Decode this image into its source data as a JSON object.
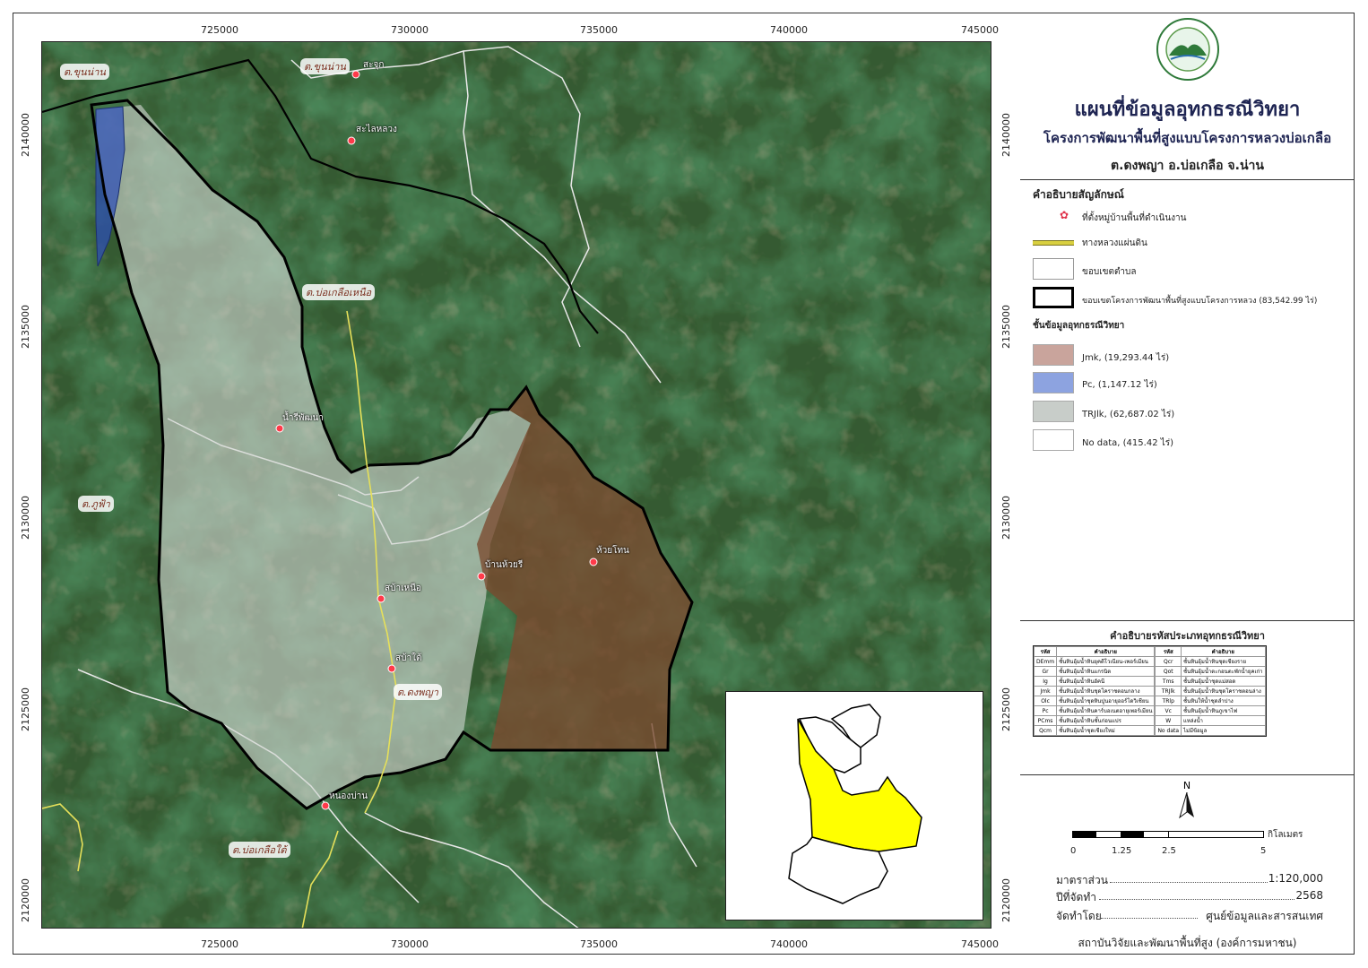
{
  "header": {
    "title": "แผนที่ข้อมูลอุทกธรณีวิทยา",
    "subtitle": "โครงการพัฒนาพื้นที่สูงแบบโครงการหลวงบ่อเกลือ",
    "location": "ต.ดงพญา อ.บ่อเกลือ จ.น่าน"
  },
  "axes": {
    "x_ticks": [
      "725000",
      "730000",
      "735000",
      "740000",
      "745000"
    ],
    "y_ticks": [
      "2140000",
      "2135000",
      "2130000",
      "2125000",
      "2120000"
    ]
  },
  "legend": {
    "heading": "คำอธิบายสัญลักษณ์",
    "village": "ที่ตั้งหมู่บ้านพื้นที่ดำเนินงาน",
    "road": "ทางหลวงแผ่นดิน",
    "subdistrict": "ขอบเขตตำบล",
    "project": "ขอบเขตโครงการพัฒนาพื้นที่สูงแบบโครงการหลวง (83,542.99 ไร่)",
    "layer_heading": "ชั้นข้อมูลอุทกธรณีวิทยา",
    "layers": [
      {
        "label": "Jmk, (19,293.44 ไร่)",
        "color": "#c9a49c"
      },
      {
        "label": "Pc, (1,147.12 ไร่)",
        "color": "#8da3e0"
      },
      {
        "label": "TRJlk, (62,687.02 ไร่)",
        "color": "#c8cdc9"
      },
      {
        "label": "No data, (415.42 ไร่)",
        "color": "#ffffff"
      }
    ]
  },
  "codes": {
    "heading": "คำอธิบายรหัสประเภทอุทกธรณีวิทยา",
    "col_code": "รหัส",
    "col_desc": "คำอธิบาย",
    "left": [
      [
        "DEmm",
        "ชั้นหินอุ้มน้ำหินยุคดีโวเนียน-เพอร์เมียน"
      ],
      [
        "Gr",
        "ชั้นหินอุ้มน้ำหินแกรนิต"
      ],
      [
        "Ig",
        "ชั้นหินอุ้มน้ำหินอัคนี"
      ],
      [
        "Jmk",
        "ชั้นหินอุ้มน้ำหินชุดโคราชตอนกลาง"
      ],
      [
        "Olc",
        "ชั้นหินอุ้มน้ำชุดหินปูนอายุออร์โดวิเชียน"
      ],
      [
        "Pc",
        "ชั้นหินอุ้มน้ำหินคาร์บอเนตอายุเพอร์เมียน"
      ],
      [
        "PCms",
        "ชั้นหินอุ้มน้ำหินชั้นก่อนแปร"
      ],
      [
        "Qcm",
        "ชั้นหินอุ้มน้ำชุดเชียงใหม่"
      ]
    ],
    "right": [
      [
        "Qcr",
        "ชั้นหินอุ้มน้ำหินชุดเชียงราย"
      ],
      [
        "Qot",
        "ชั้นหินอุ้มน้ำตะกอนตะพักน้ำยุคเก่า"
      ],
      [
        "Tms",
        "ชั้นหินอุ้มน้ำชุดแม่สอด"
      ],
      [
        "TRJlk",
        "ชั้นหินอุ้มน้ำหินชุดโคราชตอนล่าง"
      ],
      [
        "TRlp",
        "ชั้นหินให้น้ำชุดลำปาง"
      ],
      [
        "Vc",
        "ชั้นหินอุ้มน้ำหินภูเขาไฟ"
      ],
      [
        "W",
        "แหล่งน้ำ"
      ],
      [
        "No data",
        "ไม่มีข้อมูล"
      ]
    ]
  },
  "scale": {
    "north": "N",
    "unit": "กิโลเมตร",
    "labels": [
      "0",
      "1.25",
      "2.5",
      "5"
    ]
  },
  "info": {
    "scale_label": "มาตราส่วน",
    "scale_value": "1:120,000",
    "year_label": "ปีที่จัดทำ",
    "year_value": "2568",
    "by_label": "จัดทำโดย",
    "by_value": "ศูนย์ข้อมูลและสารสนเทศ",
    "org": "สถาบันวิจัยและพัฒนาพื้นที่สูง (องค์การมหาชน)"
  },
  "map_labels": {
    "tambon": [
      "ต.ขุนน่าน",
      "ต.ขุนน่าน",
      "ต.บ่อเกลือเหนือ",
      "ต.ภูฟ้า",
      "ต.ดงพญา",
      "ต.บ่อเกลือใต้"
    ],
    "villages": [
      "สะจุก",
      "สะไลหลวง",
      "น้ำรีพัฒนา",
      "ห้วยโทน",
      "บ้านห้วยรี",
      "สบ้าเหนือ",
      "สบ้าใต้",
      "หนองบ่าน"
    ]
  },
  "colors": {
    "title": "#1e2452",
    "boundary": "#000000",
    "road": "#e8e05a",
    "inset_fill": "#ffff00"
  }
}
